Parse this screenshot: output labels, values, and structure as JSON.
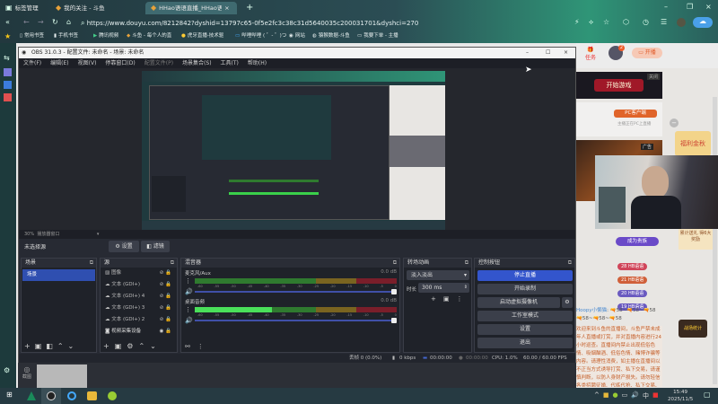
{
  "browser": {
    "tabs": [
      {
        "label": "标签管理"
      },
      {
        "label": "我的关注 - 斗鱼"
      },
      {
        "label": "HHao语语直播_HHao语语i"
      }
    ],
    "url": "https://www.douyu.com/8212842?dyshid=13797c65-0f5e2fc3c38c31d5640035c200031701&dyshci=270",
    "bookmarks": [
      "常用书签",
      "手机书签",
      "腾讯视频",
      "斗鱼 - 每个人的直",
      "虎牙直播-技术驱",
      "哔哩哔哩 ( ゜- ゜)つ",
      "网站",
      "猿猴数据-斗鱼",
      "我要下单 - 主播"
    ]
  },
  "douyu": {
    "task_label": "任务",
    "notif_count": "2",
    "live_button": "开播",
    "ad_banner": "开始游戏",
    "ad_close": "关闭",
    "pc_client": "PC客户端",
    "pc_client_sub": "主播正在PC上直播",
    "ad_label": "广告",
    "promo": "福利金秋",
    "gift_promo": "累计送礼 得6大奖励",
    "rank_badge": "成为贵族",
    "fan_badges": [
      {
        "level": "28",
        "name": "HB语语",
        "color": "#d0455a"
      },
      {
        "level": "21",
        "name": "HB语语",
        "color": "#d0603a"
      },
      {
        "level": "20",
        "name": "HB语语",
        "color": "#6a5ac0"
      },
      {
        "level": "19",
        "name": "HB语语",
        "color": "#6a5ac0"
      }
    ],
    "chat_user": "Hoopy小懒猫",
    "chat_msg": "🔫58~🔫58~🔫58",
    "chat_msg2": "🔫58~🔫58~🔫58",
    "notice": "欢迎来到斗鱼的直播间，斗鱼严禁未成年人直播或打赏，并对直播内容进行24小时巡查。直播间内禁止出现低俗色情、吸烟酗酒、低俗色情、赌博诈骗等内容。请理性消费，如主播在直播间以不正当方式诱导打赏、私下交易，请谨慎判断，以防人身财产损失。请勿轻信各类招聘征婚、代练代抢、私下交易、购买礼包码、游戏币等广告",
    "event_logo": "战场统计"
  },
  "obs": {
    "title": "OBS 31.0.3 - 配置文件: 未命名 - 场景: 未命名",
    "menu": [
      "文件(F)",
      "编辑(E)",
      "视图(V)",
      "停靠窗口(D)",
      "配置文件(P)",
      "场景集合(S)",
      "工具(T)",
      "帮助(H)"
    ],
    "zoom_level": "30%",
    "preview_mode": "播放器窗口",
    "no_source": "未选择源",
    "settings_btn": "设置",
    "filters_btn": "滤镜",
    "scenes": {
      "title": "场景",
      "items": [
        "场景"
      ]
    },
    "sources": {
      "title": "源",
      "items": [
        {
          "icon": "image-icon",
          "label": "图像"
        },
        {
          "icon": "text-icon",
          "label": "文本 (GDI+)"
        },
        {
          "icon": "text-icon",
          "label": "文本 (GDI+) 4"
        },
        {
          "icon": "text-icon",
          "label": "文本 (GDI+) 3"
        },
        {
          "icon": "text-icon",
          "label": "文本 (GDI+) 2"
        },
        {
          "icon": "camera-icon",
          "label": "视频采集设备"
        }
      ]
    },
    "mixer": {
      "title": "混音器",
      "channels": [
        {
          "name": "麦克风/Aux",
          "db": "0.0 dB",
          "level": 0.0
        },
        {
          "name": "桌面音频",
          "db": "0.0 dB",
          "level": 0.38
        }
      ],
      "ticks": [
        "-60",
        "-55",
        "-50",
        "-45",
        "-40",
        "-35",
        "-30",
        "-25",
        "-20",
        "-15",
        "-10",
        "-5",
        "0"
      ]
    },
    "transitions": {
      "title": "转场动画",
      "selected": "淡入淡出",
      "duration_label": "时长",
      "duration": "300 ms"
    },
    "controls": {
      "title": "控制按钮",
      "buttons": [
        "停止直播",
        "开始录制",
        "启动虚拟摄像机",
        "工作室模式",
        "设置",
        "退出"
      ]
    },
    "status": {
      "dropped": "丢帧 0 (0.0%)",
      "kbps": "0 kbps",
      "stream_time": "00:00:00",
      "rec_time": "00:00:00",
      "cpu": "CPU: 1.0%",
      "fps": "60.00 / 60.00 FPS"
    }
  },
  "screenshot_tool": {
    "label": "截图"
  },
  "taskbar": {
    "time": "15:49",
    "date": "2025/11/5",
    "ime": "中"
  },
  "colors": {
    "accent": "#3355cc",
    "obs_bg": "#272a33",
    "douyu_orange": "#f46d3c"
  }
}
